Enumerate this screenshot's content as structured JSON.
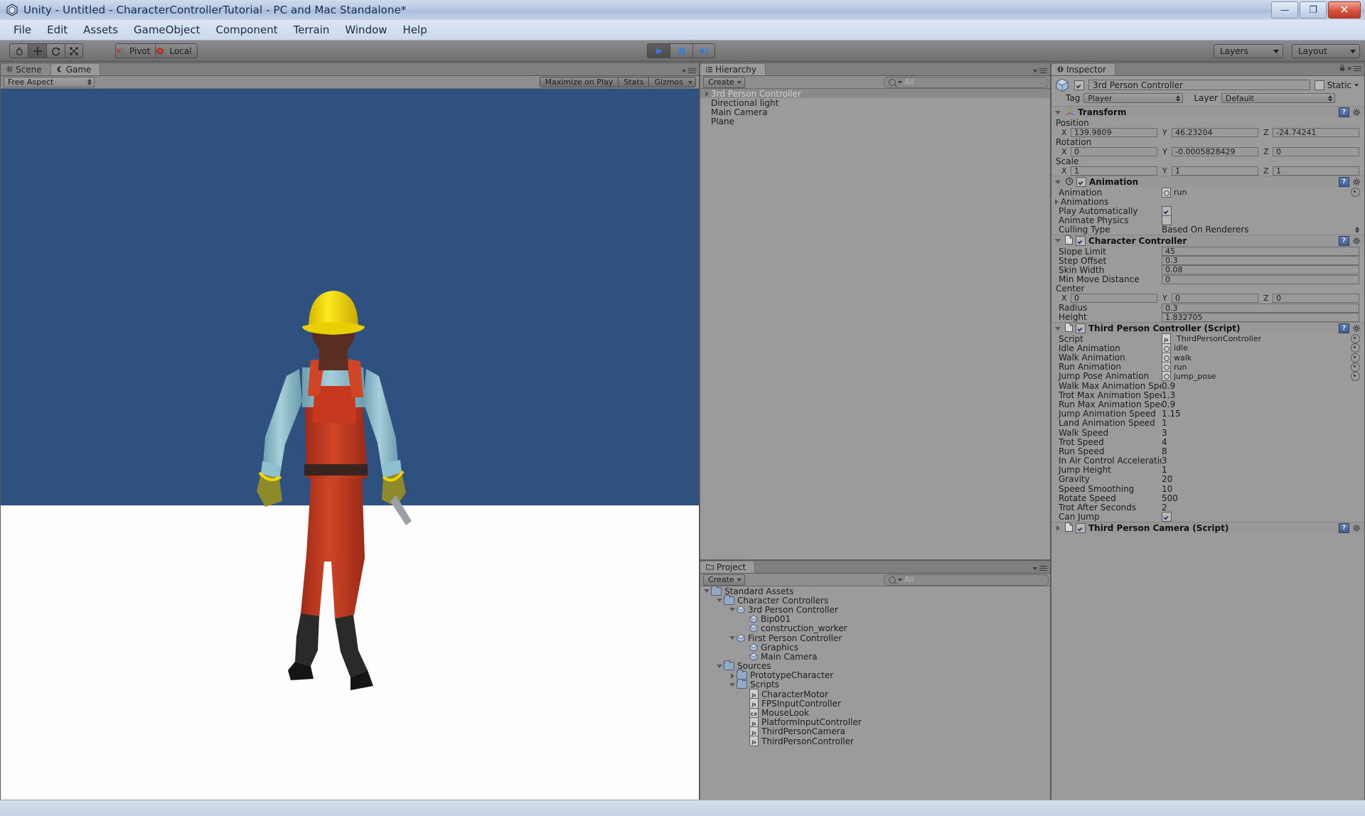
{
  "window": {
    "title": "Unity - Untitled - CharacterControllerTutorial - PC and Mac Standalone*",
    "app_icon": "unity-icon",
    "minimize_label": "—",
    "restore_label": "❐",
    "close_label": "✕"
  },
  "menu": {
    "items": [
      "File",
      "Edit",
      "Assets",
      "GameObject",
      "Component",
      "Terrain",
      "Window",
      "Help"
    ]
  },
  "toolbar": {
    "transform_tools": [
      {
        "name": "hand-tool",
        "icon": "hand-icon",
        "active": false
      },
      {
        "name": "move-tool",
        "icon": "move-icon",
        "active": true
      },
      {
        "name": "rotate-tool",
        "icon": "rotate-icon",
        "active": false
      },
      {
        "name": "scale-tool",
        "icon": "scale-icon",
        "active": false
      }
    ],
    "pivot_label": "Pivot",
    "local_label": "Local",
    "play_label": "▶",
    "pause_label": "⏸",
    "step_label": "⏭",
    "playing": true,
    "layers_label": "Layers",
    "layout_label": "Layout"
  },
  "gameview": {
    "tabs": [
      {
        "label": "Scene",
        "icon": "grid-icon",
        "active": false
      },
      {
        "label": "Game",
        "icon": "gamepad-icon",
        "active": true
      }
    ],
    "aspect_label": "Free Aspect",
    "maximize_label": "Maximize on Play",
    "stats_label": "Stats",
    "gizmos_label": "Gizmos",
    "sky_color": "#2f5180",
    "ground_color": "#fdfdfd",
    "character": {
      "helmet_color": "#f2d400",
      "shirt_color": "#8fc0ce",
      "overalls_color": "#c6391f",
      "glove_color": "#8e8a2c",
      "skin_color": "#5c2f25",
      "boot_color": "#1a1a1a",
      "belt_color": "#3a2420"
    }
  },
  "hierarchy": {
    "tab_label": "Hierarchy",
    "tab_icon": "hierarchy-icon",
    "create_label": "Create",
    "search_placeholder": "All",
    "items": [
      {
        "label": "3rd Person Controller",
        "expandable": true,
        "selected": true,
        "indent": 0
      },
      {
        "label": "Directional light",
        "expandable": false,
        "selected": false,
        "indent": 0
      },
      {
        "label": "Main Camera",
        "expandable": false,
        "selected": false,
        "indent": 0
      },
      {
        "label": "Plane",
        "expandable": false,
        "selected": false,
        "indent": 0
      }
    ]
  },
  "project": {
    "tab_label": "Project",
    "tab_icon": "folder-icon",
    "create_label": "Create",
    "search_placeholder": "All",
    "items": [
      {
        "label": "Standard Assets",
        "indent": 0,
        "icon": "folder",
        "toggle": "down"
      },
      {
        "label": "Character Controllers",
        "indent": 1,
        "icon": "folder",
        "toggle": "down"
      },
      {
        "label": "3rd Person Controller",
        "indent": 2,
        "icon": "prefab",
        "toggle": "down"
      },
      {
        "label": "Bip001",
        "indent": 3,
        "icon": "prefab",
        "toggle": "none"
      },
      {
        "label": "construction_worker",
        "indent": 3,
        "icon": "prefab",
        "toggle": "none"
      },
      {
        "label": "First Person Controller",
        "indent": 2,
        "icon": "prefab",
        "toggle": "down"
      },
      {
        "label": "Graphics",
        "indent": 3,
        "icon": "prefab",
        "toggle": "none"
      },
      {
        "label": "Main Camera",
        "indent": 3,
        "icon": "prefab",
        "toggle": "none"
      },
      {
        "label": "Sources",
        "indent": 1,
        "icon": "folder",
        "toggle": "down"
      },
      {
        "label": "PrototypeCharacter",
        "indent": 2,
        "icon": "folder",
        "toggle": "right"
      },
      {
        "label": "Scripts",
        "indent": 2,
        "icon": "folder",
        "toggle": "down"
      },
      {
        "label": "CharacterMotor",
        "indent": 3,
        "icon": "js",
        "toggle": "none"
      },
      {
        "label": "FPSInputController",
        "indent": 3,
        "icon": "js",
        "toggle": "none"
      },
      {
        "label": "MouseLook",
        "indent": 3,
        "icon": "cs",
        "toggle": "none"
      },
      {
        "label": "PlatformInputController",
        "indent": 3,
        "icon": "js",
        "toggle": "none"
      },
      {
        "label": "ThirdPersonCamera",
        "indent": 3,
        "icon": "js",
        "toggle": "none"
      },
      {
        "label": "ThirdPersonController",
        "indent": 3,
        "icon": "js",
        "toggle": "none"
      }
    ]
  },
  "inspector": {
    "tab_label": "Inspector",
    "tab_icon": "info-icon",
    "object_name": "3rd Person Controller",
    "enabled": true,
    "static_label": "Static",
    "static_checked": false,
    "tag_label": "Tag",
    "tag_value": "Player",
    "layer_label": "Layer",
    "layer_value": "Default",
    "components": [
      {
        "name": "Transform",
        "icon": "transform-icon",
        "expanded": true,
        "has_checkbox": false,
        "vectors": [
          {
            "label": "Position",
            "x": "139.9809",
            "y": "46.23204",
            "z": "-24.74241"
          },
          {
            "label": "Rotation",
            "x": "0",
            "y": "-0.0005828429",
            "z": "0"
          },
          {
            "label": "Scale",
            "x": "1",
            "y": "1",
            "z": "1"
          }
        ]
      },
      {
        "name": "Animation",
        "icon": "clock-icon",
        "expanded": true,
        "has_checkbox": true,
        "checked": true,
        "rows": [
          {
            "label": "Animation",
            "type": "objref",
            "value": "run",
            "ref_icon": "anim-clip-icon"
          },
          {
            "label": "Animations",
            "type": "foldout"
          },
          {
            "label": "Play Automatically",
            "type": "checkbox",
            "checked": true
          },
          {
            "label": "Animate Physics",
            "type": "checkbox",
            "checked": false
          },
          {
            "label": "Culling Type",
            "type": "popup",
            "value": "Based On Renderers"
          }
        ]
      },
      {
        "name": "Character Controller",
        "icon": "script-icon",
        "expanded": true,
        "has_checkbox": true,
        "checked": true,
        "rows": [
          {
            "label": "Slope Limit",
            "type": "field",
            "value": "45"
          },
          {
            "label": "Step Offset",
            "type": "field",
            "value": "0.3"
          },
          {
            "label": "Skin Width",
            "type": "field",
            "value": "0.08"
          },
          {
            "label": "Min Move Distance",
            "type": "field",
            "value": "0"
          },
          {
            "label": "Center",
            "type": "vector",
            "x": "0",
            "y": "0",
            "z": "0"
          },
          {
            "label": "Radius",
            "type": "field",
            "value": "0.3"
          },
          {
            "label": "Height",
            "type": "field",
            "value": "1.832705"
          }
        ]
      },
      {
        "name": "Third Person Controller (Script)",
        "icon": "script-icon",
        "expanded": true,
        "has_checkbox": true,
        "checked": true,
        "rows": [
          {
            "label": "Script",
            "type": "objref",
            "value": "ThirdPersonController",
            "ref_icon": "js-script-icon"
          },
          {
            "label": "Idle Animation",
            "type": "objref",
            "value": "idle",
            "ref_icon": "anim-clip-icon"
          },
          {
            "label": "Walk Animation",
            "type": "objref",
            "value": "walk",
            "ref_icon": "anim-clip-icon"
          },
          {
            "label": "Run Animation",
            "type": "objref",
            "value": "run",
            "ref_icon": "anim-clip-icon"
          },
          {
            "label": "Jump Pose Animation",
            "type": "objref",
            "value": "jump_pose",
            "ref_icon": "anim-clip-icon"
          },
          {
            "label": "Walk Max Animation Speed",
            "type": "text",
            "value": "0.9"
          },
          {
            "label": "Trot Max Animation Speed",
            "type": "text",
            "value": "1.3"
          },
          {
            "label": "Run Max Animation Speed",
            "type": "text",
            "value": "0.9"
          },
          {
            "label": "Jump Animation Speed",
            "type": "text",
            "value": "1.15"
          },
          {
            "label": "Land Animation Speed",
            "type": "text",
            "value": "1"
          },
          {
            "label": "Walk Speed",
            "type": "text",
            "value": "3"
          },
          {
            "label": "Trot Speed",
            "type": "text",
            "value": "4"
          },
          {
            "label": "Run Speed",
            "type": "text",
            "value": "8"
          },
          {
            "label": "In Air Control Acceleration",
            "type": "text",
            "value": "3"
          },
          {
            "label": "Jump Height",
            "type": "text",
            "value": "1"
          },
          {
            "label": "Gravity",
            "type": "text",
            "value": "20"
          },
          {
            "label": "Speed Smoothing",
            "type": "text",
            "value": "10"
          },
          {
            "label": "Rotate Speed",
            "type": "text",
            "value": "500"
          },
          {
            "label": "Trot After Seconds",
            "type": "text",
            "value": "2"
          },
          {
            "label": "Can Jump",
            "type": "checkbox",
            "checked": true
          }
        ]
      },
      {
        "name": "Third Person Camera (Script)",
        "icon": "script-icon",
        "expanded": false,
        "has_checkbox": true,
        "checked": true,
        "rows": []
      }
    ]
  }
}
